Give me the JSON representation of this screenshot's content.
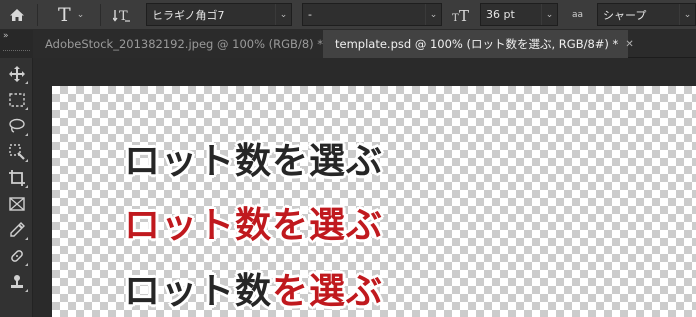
{
  "options_bar": {
    "home_icon": "home-icon",
    "tool_icon": "text-tool-icon",
    "orientation_icon": "text-orientation-icon",
    "font_family": "ヒラギノ角ゴ7",
    "font_style": "-",
    "font_size_icon": "font-size-icon",
    "font_size": "36 pt",
    "antialias_icon": "aa",
    "antialias": "シャープ"
  },
  "tabs": [
    {
      "label": "AdobeStock_201382192.jpeg @ 100% (RGB/8) *",
      "active": false
    },
    {
      "label": "template.psd @ 100% (ロット数を選ぶ, RGB/8#) *",
      "active": true
    }
  ],
  "tools": [
    "move-tool-icon",
    "marquee-tool-icon",
    "lasso-tool-icon",
    "quick-select-tool-icon",
    "crop-tool-icon",
    "frame-tool-icon",
    "eyedropper-tool-icon",
    "healing-brush-tool-icon",
    "stamp-tool-icon"
  ],
  "canvas": {
    "line1": "ロット数を選ぶ",
    "line2": "ロット数を選ぶ",
    "line3_part1": "ロット数",
    "line3_part2": "を選ぶ",
    "colors": {
      "black": "#262626",
      "red": "#c0191e"
    }
  }
}
